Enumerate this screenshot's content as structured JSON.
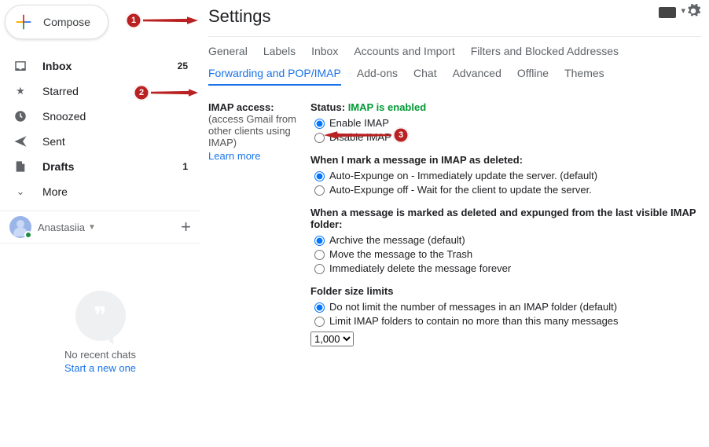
{
  "compose_label": "Compose",
  "sidebar": {
    "items": [
      {
        "label": "Inbox",
        "count": "25"
      },
      {
        "label": "Starred",
        "count": ""
      },
      {
        "label": "Snoozed",
        "count": ""
      },
      {
        "label": "Sent",
        "count": ""
      },
      {
        "label": "Drafts",
        "count": "1"
      },
      {
        "label": "More",
        "count": ""
      }
    ]
  },
  "account": {
    "name": "Anastasiia"
  },
  "hangouts": {
    "no_chats": "No recent chats",
    "start_new": "Start a new one"
  },
  "page_title": "Settings",
  "tabs_row1": [
    "General",
    "Labels",
    "Inbox",
    "Accounts and Import",
    "Filters and Blocked Addresses"
  ],
  "tabs_row2": [
    "Forwarding and POP/IMAP",
    "Add-ons",
    "Chat",
    "Advanced",
    "Offline",
    "Themes"
  ],
  "active_tab": "Forwarding and POP/IMAP",
  "imap": {
    "heading": "IMAP access:",
    "note1": "(access Gmail from",
    "note2": "other clients using",
    "note3": "IMAP)",
    "learn": "Learn more",
    "status_label": "Status:",
    "status_value": "IMAP is enabled",
    "enable": "Enable IMAP",
    "disable": "Disable IMAP"
  },
  "deleted": {
    "heading": "When I mark a message in IMAP as deleted:",
    "opt1": "Auto-Expunge on - Immediately update the server. (default)",
    "opt2": "Auto-Expunge off - Wait for the client to update the server."
  },
  "expunged": {
    "heading": "When a message is marked as deleted and expunged from the last visible IMAP folder:",
    "opt1": "Archive the message (default)",
    "opt2": "Move the message to the Trash",
    "opt3": "Immediately delete the message forever"
  },
  "folder": {
    "heading": "Folder size limits",
    "opt1": "Do not limit the number of messages in an IMAP folder (default)",
    "opt2": "Limit IMAP folders to contain no more than this many messages",
    "select_value": "1,000"
  },
  "annotations": {
    "a1": "1",
    "a2": "2",
    "a3": "3"
  }
}
